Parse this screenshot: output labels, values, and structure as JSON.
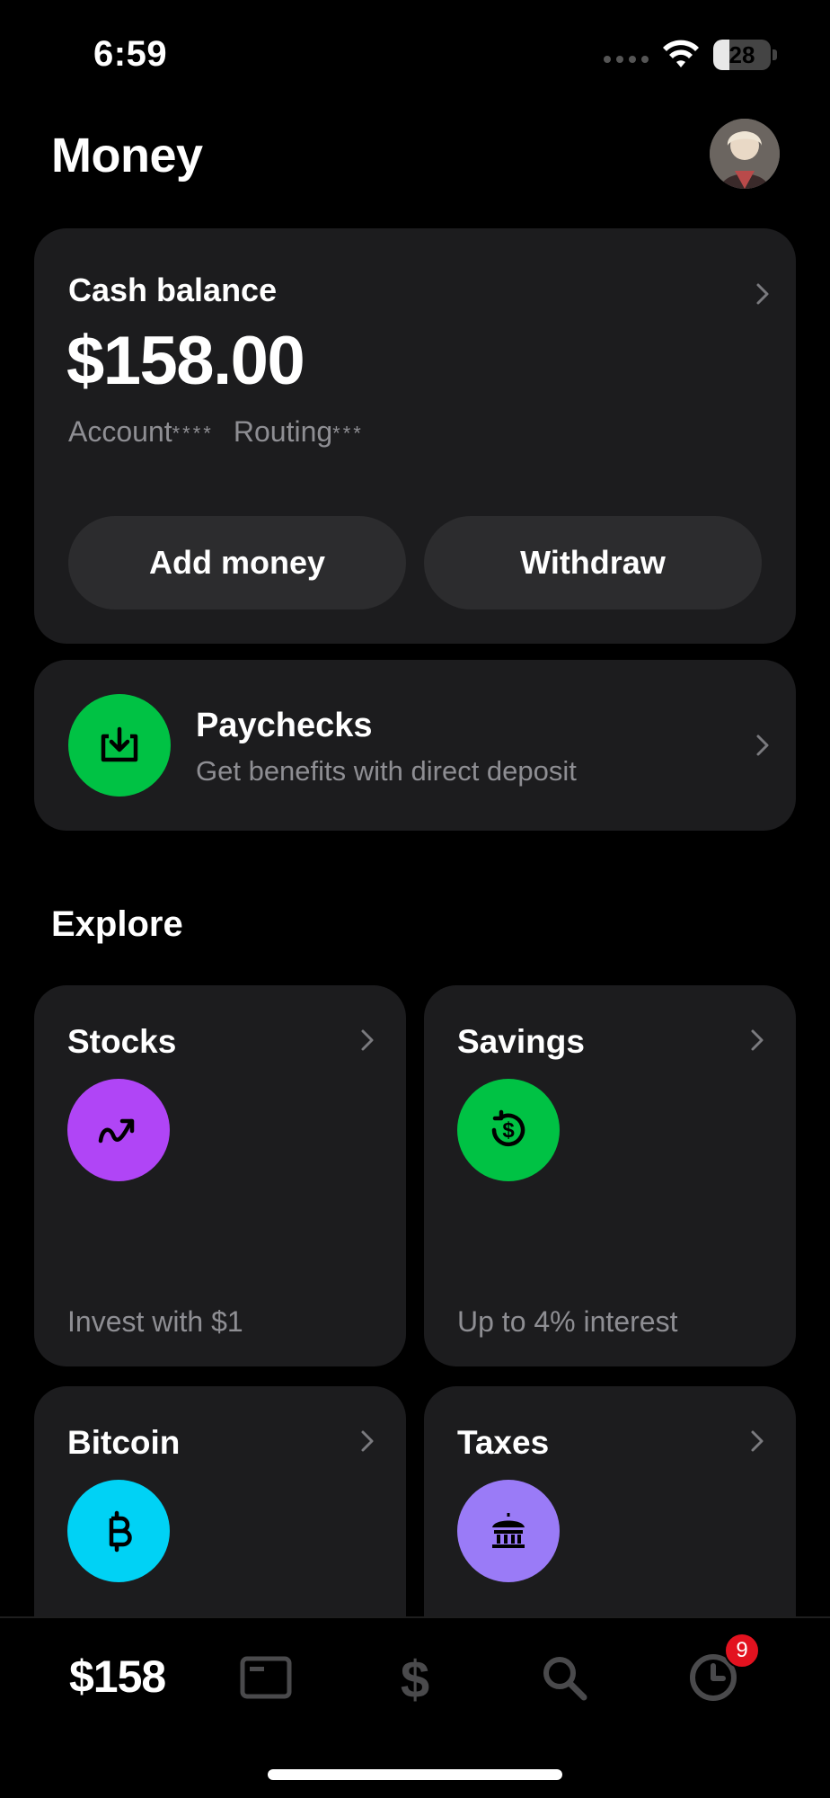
{
  "status_bar": {
    "time": "6:59",
    "battery_level": "28"
  },
  "header": {
    "title": "Money"
  },
  "balance_card": {
    "label": "Cash balance",
    "amount": "$158.00",
    "account_label": "Account",
    "account_mask": "****",
    "routing_label": "Routing",
    "routing_mask": "***",
    "add_money_label": "Add money",
    "withdraw_label": "Withdraw"
  },
  "paychecks": {
    "title": "Paychecks",
    "subtitle": "Get benefits with direct deposit",
    "icon": "deposit-tray-icon",
    "color": "#00c244"
  },
  "explore": {
    "title": "Explore",
    "tiles": [
      {
        "title": "Stocks",
        "subtitle": "Invest with $1",
        "icon": "trend-arrow-icon",
        "color": "#b045f6"
      },
      {
        "title": "Savings",
        "subtitle": "Up to 4% interest",
        "icon": "dollar-circle-icon",
        "color": "#00c244"
      },
      {
        "title": "Bitcoin",
        "subtitle": "",
        "icon": "bitcoin-icon",
        "color": "#00d2f5"
      },
      {
        "title": "Taxes",
        "subtitle": "",
        "icon": "bank-icon",
        "color": "#9a7bf7"
      }
    ]
  },
  "tab_bar": {
    "balance": "$158",
    "activity_badge": "9",
    "icons": [
      "card-icon",
      "dollar-icon",
      "search-icon",
      "clock-icon"
    ]
  },
  "colors": {
    "background": "#000000",
    "card": "#1c1c1e",
    "pill": "#2c2c2e",
    "muted_text": "#8e8e93",
    "badge": "#e3121f"
  }
}
